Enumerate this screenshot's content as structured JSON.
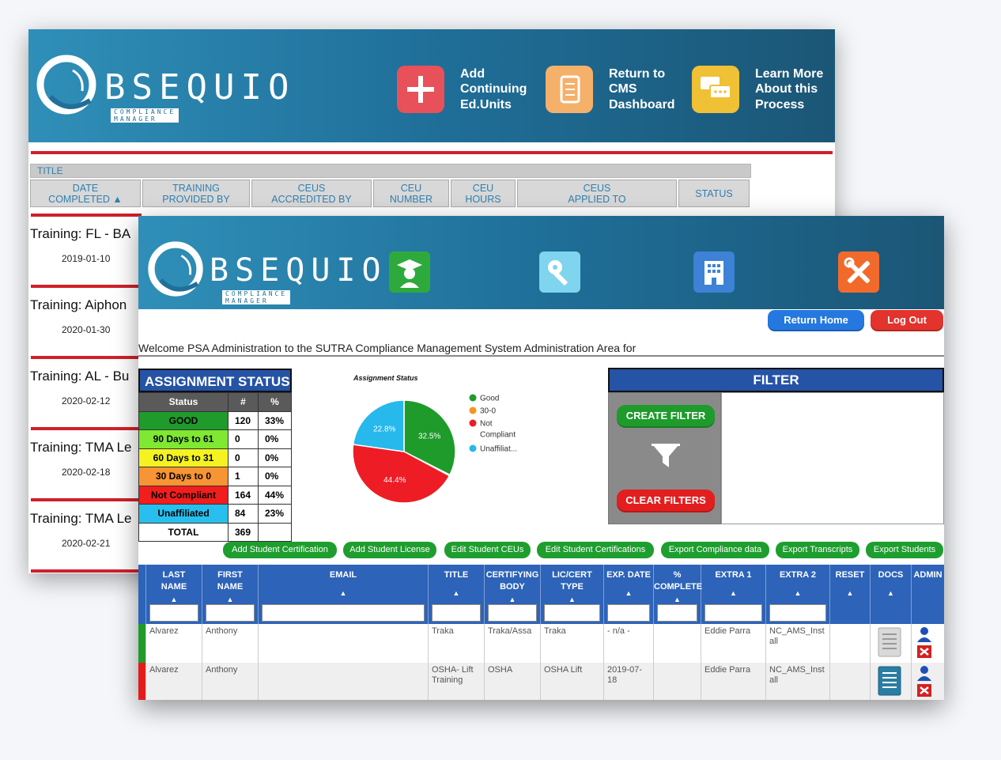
{
  "back": {
    "logo_text": "BSEQUIO",
    "logo_sub": "COMPLIANCE MANAGER",
    "buttons": [
      {
        "label": "Add\nContinuing\nEd.Units",
        "color": "#e8505a",
        "icon": "plus-icon"
      },
      {
        "label": "Return to\nCMS\nDashboard",
        "color": "#f5b06a",
        "icon": "document-icon"
      },
      {
        "label": "Learn More\nAbout this\nProcess",
        "color": "#f0c035",
        "icon": "chat-icon"
      }
    ],
    "title_label": "TITLE",
    "columns": [
      "DATE\nCOMPLETED ▲",
      "TRAINING\nPROVIDED BY",
      "CEUS\nACCREDITED BY",
      "CEU\nNUMBER",
      "CEU\nHOURS",
      "CEUS\nAPPLIED TO",
      "STATUS"
    ],
    "rows": [
      {
        "title": "Training: FL - BA",
        "date": "2019-01-10"
      },
      {
        "title": "Training: Aiphon",
        "date": "2020-01-30"
      },
      {
        "title": "Training: AL - Bu",
        "date": "2020-02-12"
      },
      {
        "title": "Training: TMA Le",
        "date": "2020-02-18"
      },
      {
        "title": "Training: TMA Le",
        "date": "2020-02-21"
      }
    ]
  },
  "front": {
    "logo_text": "BSEQUIO",
    "logo_sub": "COMPLIANCE MANAGER",
    "nav": [
      {
        "label": "Student\nManagement",
        "color": "#2eaa3c",
        "icon": "graduate-icon"
      },
      {
        "label": "Administrator\nManagement",
        "color": "#7fd4ee",
        "icon": "key-icon"
      },
      {
        "label": "Company\nProfile",
        "color": "#3d82d6",
        "icon": "building-icon"
      },
      {
        "label": "Settings",
        "color": "#f26a2b",
        "icon": "tools-icon"
      }
    ],
    "return_home": "Return Home",
    "log_out": "Log Out",
    "welcome": "Welcome PSA Administration to the SUTRA Compliance Management System Administration Area for",
    "status": {
      "title": "ASSIGNMENT STATUS",
      "headers": [
        "Status",
        "#",
        "%"
      ],
      "rows": [
        {
          "label": "GOOD",
          "count": "120",
          "pct": "33%",
          "color": "#1f9b2c"
        },
        {
          "label": "90 Days to 61",
          "count": "0",
          "pct": "0%",
          "color": "#7ee832"
        },
        {
          "label": "60 Days to 31",
          "count": "0",
          "pct": "0%",
          "color": "#f4f321"
        },
        {
          "label": "30 Days to 0",
          "count": "1",
          "pct": "0%",
          "color": "#f79433"
        },
        {
          "label": "Not Compliant",
          "count": "164",
          "pct": "44%",
          "color": "#f21d1d"
        },
        {
          "label": "Unaffiliated",
          "count": "84",
          "pct": "23%",
          "color": "#27c0ee"
        }
      ],
      "total_label": "TOTAL",
      "total": "369"
    },
    "filter": {
      "title": "FILTER",
      "create": "CREATE FILTER",
      "clear": "CLEAR FILTERS"
    },
    "actions": [
      "Add Student Certification",
      "Add Student License",
      "Edit Student CEUs",
      "Edit Student Certifications",
      "Export Compliance data",
      "Export Transcripts",
      "Export Students"
    ],
    "grid": {
      "columns": [
        "LAST\nNAME",
        "FIRST\nNAME",
        "EMAIL",
        "TITLE",
        "CERTIFYING\nBODY",
        "LIC/CERT\nTYPE",
        "EXP. DATE",
        "%\nCOMPLETE",
        "EXTRA 1",
        "EXTRA 2",
        "RESET",
        "DOCS",
        "ADMIN"
      ],
      "rows": [
        {
          "bar": "#1f9b2c",
          "bg": "#ffffff",
          "cells": [
            "Alvarez",
            "Anthony",
            "",
            "Traka",
            "Traka/Assa",
            "Traka",
            "- n/a -",
            "",
            "Eddie Parra",
            "NC_AMS_Inst\nall",
            "",
            "",
            ""
          ]
        },
        {
          "bar": "#e21b1b",
          "bg": "#efefef",
          "cells": [
            "Alvarez",
            "Anthony",
            "",
            "OSHA- Lift\nTraining",
            "OSHA",
            "OSHA Lift",
            "2019-07-18",
            "",
            "Eddie Parra",
            "NC_AMS_Inst\nall",
            "",
            "",
            ""
          ]
        }
      ]
    }
  },
  "chart_data": {
    "type": "pie",
    "title": "Assignment Status",
    "series": [
      {
        "name": "Good",
        "value": 32.5,
        "color": "#1e9b2a"
      },
      {
        "name": "30-0",
        "value": 0.3,
        "color": "#f7931e"
      },
      {
        "name": "Not\nCompliant",
        "value": 44.4,
        "color": "#ee1c25"
      },
      {
        "name": "Unaffiliat...",
        "value": 22.8,
        "color": "#27b8ec"
      }
    ],
    "data_labels": [
      "32.5%",
      "44.4%",
      "22.8%"
    ],
    "legend": "right"
  }
}
